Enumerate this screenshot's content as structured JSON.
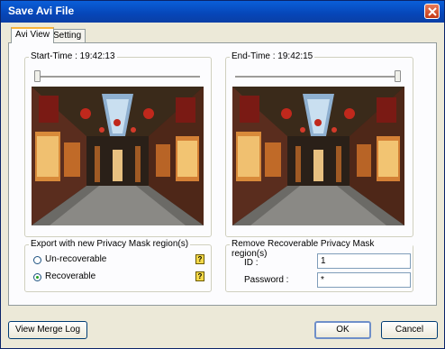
{
  "window": {
    "title": "Save Avi File"
  },
  "tabs": [
    {
      "label": "Avi View"
    },
    {
      "label": "Setting"
    }
  ],
  "start": {
    "label": "Start-Time : 19:42:13",
    "slider_value": 0
  },
  "end": {
    "label": "End-Time : 19:42:15",
    "slider_value": 1
  },
  "export_group": {
    "legend": "Export with new Privacy Mask region(s)",
    "options": [
      {
        "label": "Un-recoverable",
        "checked": false
      },
      {
        "label": "Recoverable",
        "checked": true
      }
    ],
    "help_glyph": "?"
  },
  "remove_group": {
    "legend": "Remove Recoverable Privacy Mask region(s)",
    "id_label": "ID :",
    "id_value": "1",
    "password_label": "Password :",
    "password_value": "*"
  },
  "buttons": {
    "merge_log": "View Merge Log",
    "ok": "OK",
    "cancel": "Cancel"
  },
  "colors": {
    "title_bar": "#0a5fd9",
    "tab_highlight": "#f8b33a",
    "window_bg": "#ece9d8"
  }
}
